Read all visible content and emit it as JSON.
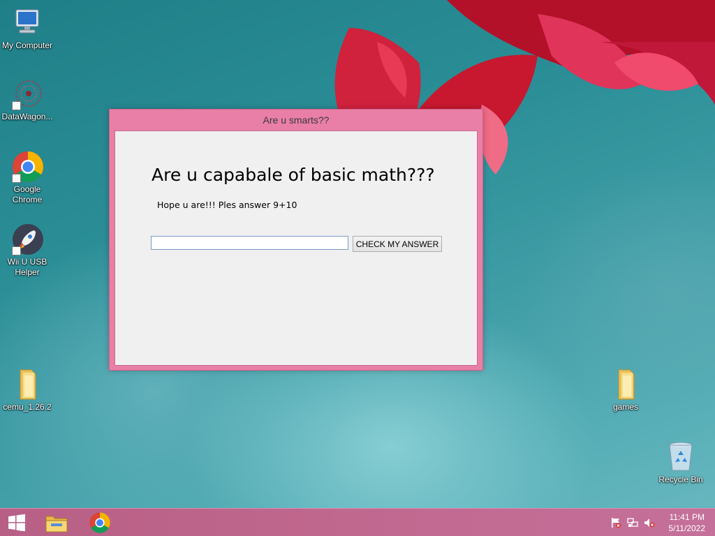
{
  "desktop": {
    "icons": [
      {
        "label": "My Computer"
      },
      {
        "label": "DataWagon..."
      },
      {
        "label": "Google Chrome"
      },
      {
        "label": "Wii U USB Helper"
      },
      {
        "label": "cemu_1.26.2"
      },
      {
        "label": "games"
      },
      {
        "label": "Recycle Bin"
      }
    ]
  },
  "window": {
    "title": "Are u smarts??",
    "heading": "Are u capabale of basic math???",
    "subheading": "Hope u are!!! Ples answer 9+10",
    "answer_value": "",
    "check_button_label": "CHECK MY ANSWER"
  },
  "taskbar": {
    "items": [
      {
        "icon": "windows-start-icon"
      },
      {
        "icon": "file-explorer-icon"
      },
      {
        "icon": "chrome-icon"
      }
    ],
    "tray": [
      {
        "icon": "action-center-flag-icon"
      },
      {
        "icon": "network-icon"
      },
      {
        "icon": "volume-muted-icon"
      }
    ],
    "time": "11:41 PM",
    "date": "5/11/2022"
  },
  "colors": {
    "window_frame": "#e97fa6",
    "taskbar": "#c1688f",
    "wallpaper": "#2b8e96"
  }
}
